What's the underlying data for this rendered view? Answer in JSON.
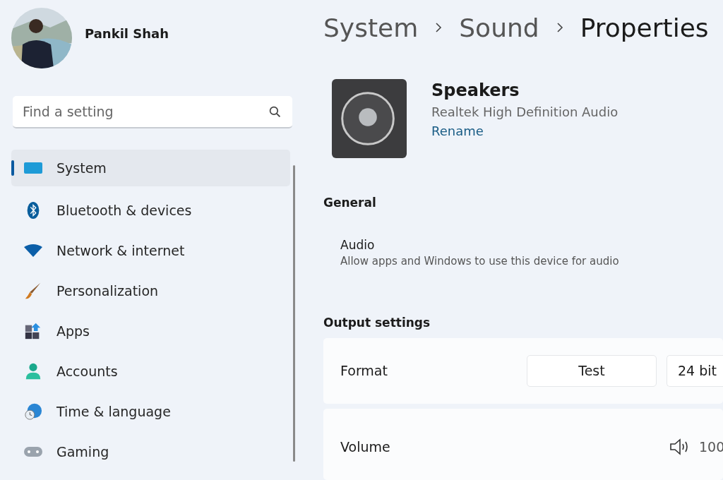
{
  "user": {
    "name": "Pankil Shah"
  },
  "search": {
    "placeholder": "Find a setting"
  },
  "nav": [
    {
      "label": "System",
      "selected": true
    },
    {
      "label": "Bluetooth & devices",
      "selected": false
    },
    {
      "label": "Network & internet",
      "selected": false
    },
    {
      "label": "Personalization",
      "selected": false
    },
    {
      "label": "Apps",
      "selected": false
    },
    {
      "label": "Accounts",
      "selected": false
    },
    {
      "label": "Time & language",
      "selected": false
    },
    {
      "label": "Gaming",
      "selected": false
    }
  ],
  "breadcrumb": [
    "System",
    "Sound",
    "Properties"
  ],
  "device": {
    "name": "Speakers",
    "driver": "Realtek High Definition Audio",
    "rename": "Rename"
  },
  "general": {
    "heading": "General",
    "title": "Audio",
    "description": "Allow apps and Windows to use this device for audio"
  },
  "output": {
    "heading": "Output settings",
    "format_label": "Format",
    "test_button": "Test",
    "format_value": "24 bit",
    "volume_label": "Volume",
    "volume_value": "100"
  }
}
